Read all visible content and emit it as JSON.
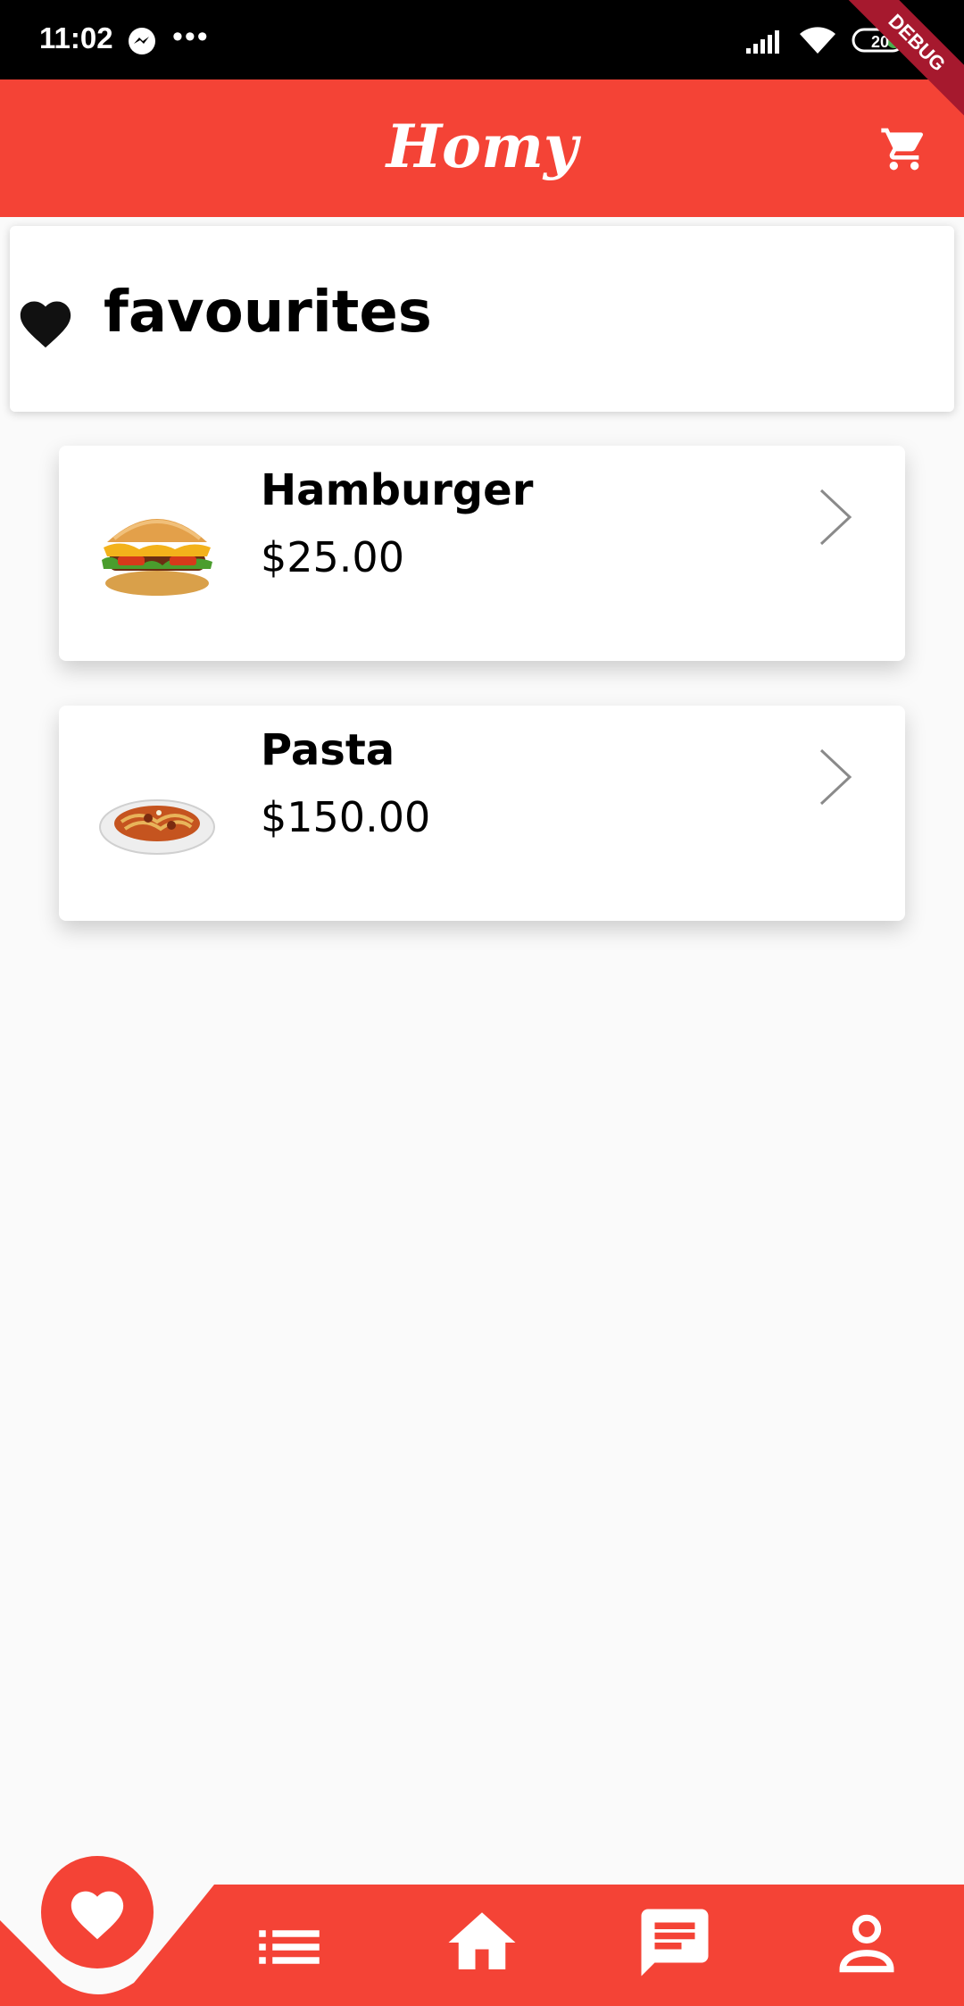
{
  "status_bar": {
    "time": "11:02",
    "battery": "20",
    "debug_label": "DEBUG"
  },
  "app_bar": {
    "title": "Homy",
    "cart_icon": "shopping-cart-icon"
  },
  "favourites_header": {
    "icon": "heart-icon",
    "title": "favourites"
  },
  "items": [
    {
      "name": "Hamburger",
      "price": "$25.00",
      "image": "hamburger-photo"
    },
    {
      "name": "Pasta",
      "price": "$150.00",
      "image": "pasta-photo"
    }
  ],
  "bottom_nav": {
    "items": [
      "heart-icon",
      "list-icon",
      "home-icon",
      "chat-icon",
      "person-icon"
    ],
    "active": "heart-icon"
  },
  "colors": {
    "accent": "#f44336",
    "background": "#fafafa"
  }
}
